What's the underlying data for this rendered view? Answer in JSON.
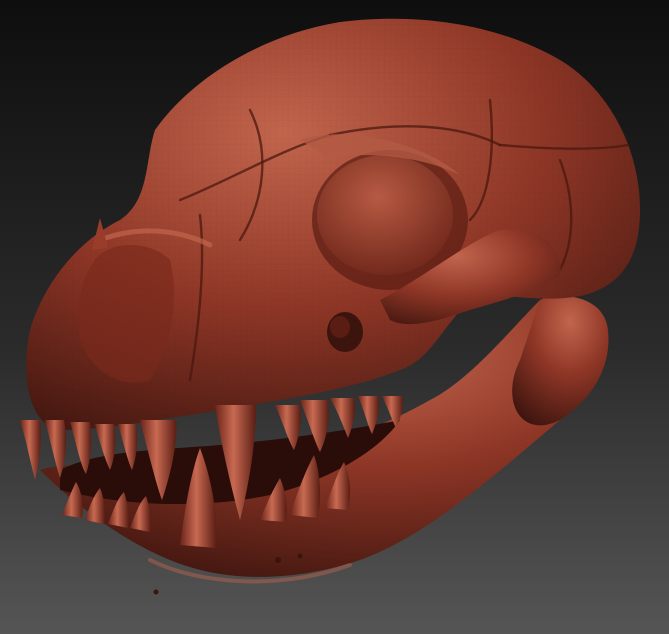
{
  "scene": {
    "subject": "sculpted-skull-model",
    "colors": {
      "background_top": "#0e0e0e",
      "background_bottom": "#555555",
      "material_base": "#8e3626",
      "material_highlight": "#c2654d",
      "material_shadow": "#3c140e",
      "tooth": "#a8432f"
    }
  }
}
